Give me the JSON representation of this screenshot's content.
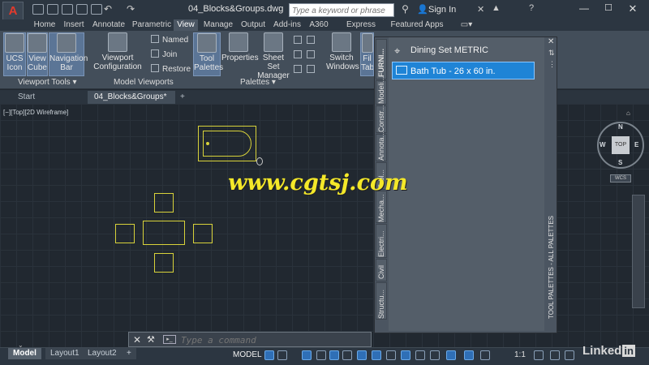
{
  "titlebar": {
    "app_logo": "A",
    "doc_title": "04_Blocks&Groups.dwg",
    "search_placeholder": "Type a keyword or phrase",
    "sign_in": "Sign In"
  },
  "ribbon_tabs": [
    "Home",
    "Insert",
    "Annotate",
    "Parametric",
    "View",
    "Manage",
    "Output",
    "Add-ins",
    "A360",
    "Express Tools",
    "Featured Apps"
  ],
  "active_tab": "View",
  "ribbon": {
    "ucs_icon": "UCS Icon",
    "view_cube": "View Cube",
    "navigation_bar": "Navigation Bar",
    "viewport_tools_label": "Viewport Tools",
    "viewport_configuration": "Viewport Configuration",
    "named": "Named",
    "join": "Join",
    "restore": "Restore",
    "model_viewports_label": "Model Viewports",
    "tool_palettes": "Tool Palettes",
    "properties": "Properties",
    "sheet_set_manager": "Sheet Set Manager",
    "palettes_label": "Palettes",
    "switch_windows": "Switch Windows",
    "file_tabs": "Fil Tab"
  },
  "file_tabs": {
    "start": "Start",
    "active": "04_Blocks&Groups*"
  },
  "viewport": {
    "label": "[−][Top][2D Wireframe]"
  },
  "palette": {
    "header": "Dining Set  METRIC",
    "selected_item": "Bath Tub - 26 x 60 in.",
    "side_title": "TOOL PALETTES - ALL PALETTES",
    "vertical_tabs": [
      "FURNI...",
      "Modeli...",
      "Constr...",
      "Annota...",
      "Tabl...",
      "Mecha...",
      "Electri...",
      "Civil",
      "Structu..."
    ]
  },
  "watermark": "www.cgtsj.com",
  "viewcube": {
    "top": "TOP",
    "n": "N",
    "s": "S",
    "e": "E",
    "w": "W",
    "wcs": "WCS"
  },
  "command_line": {
    "placeholder": "Type a command"
  },
  "statusbar": {
    "layout_tabs": [
      "Model",
      "Layout1",
      "Layout2"
    ],
    "add_tab": "+",
    "model_label": "MODEL",
    "scale": "1:1"
  },
  "branding": {
    "linkedin": "Linked",
    "linkedin_in": "in"
  },
  "colors": {
    "drawing_lines": "#d8d23a",
    "selection_blue": "#1f84d6",
    "watermark": "#f4e829"
  }
}
